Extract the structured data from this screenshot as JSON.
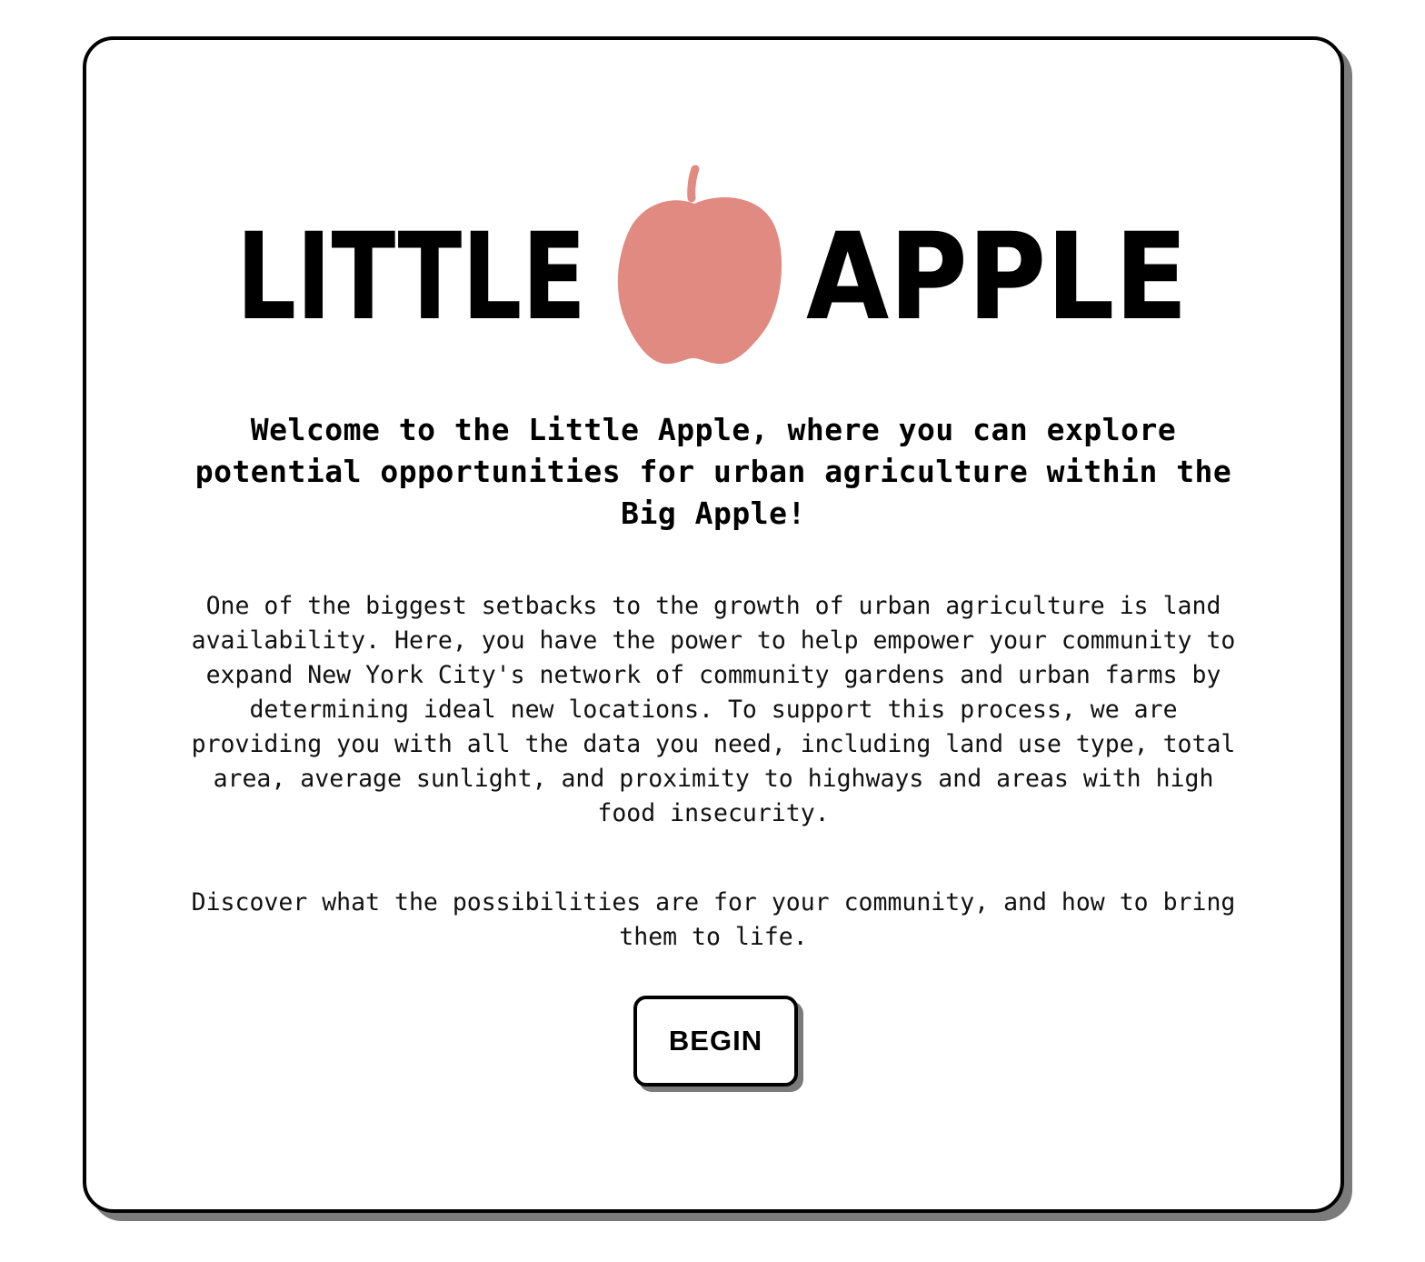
{
  "logo": {
    "word_left": "LITTLE",
    "word_right": "APPLE",
    "apple_color": "#e08a82",
    "icon": "apple-icon"
  },
  "headline": "Welcome to the Little Apple, where you can explore potential opportunities for urban agriculture within the Big Apple!",
  "paragraphs": [
    "One of the biggest setbacks to the growth of urban agriculture is land availability. Here, you have the power to help empower your community to expand New York City's network of community gardens and urban farms by determining ideal new locations. To support this process, we are providing you with all the data you need, including land use type, total area, average sunlight, and proximity to highways and areas with high food insecurity.",
    "Discover what the possibilities are for your community, and how to bring them to life."
  ],
  "begin_button": "BEGIN",
  "colors": {
    "border": "#000000",
    "shadow": "#7b7b7b",
    "background": "#ffffff"
  }
}
